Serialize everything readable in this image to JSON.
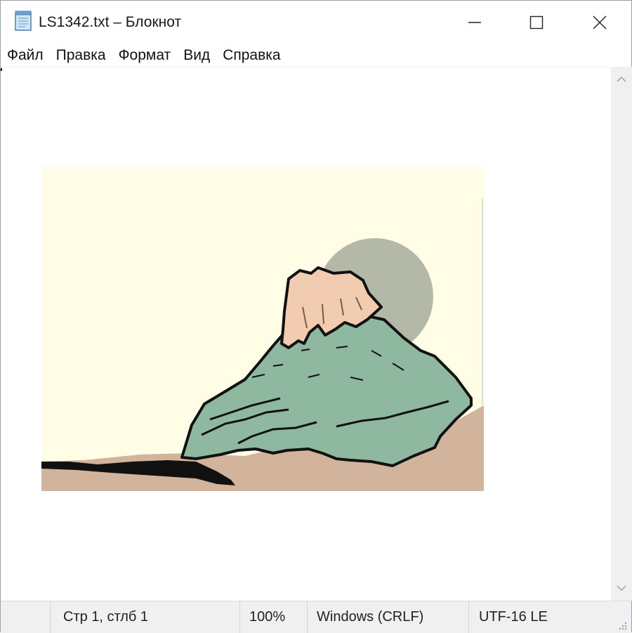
{
  "window": {
    "title": "LS1342.txt – Блокнот",
    "icon": "notepad-icon",
    "controls": [
      "minimize-icon",
      "maximize-icon",
      "close-icon"
    ]
  },
  "menu": {
    "items": [
      "Файл",
      "Правка",
      "Формат",
      "Вид",
      "Справка"
    ]
  },
  "editor": {
    "content": "mountain-clipart-image",
    "colors": {
      "sky": "#fffde6",
      "sun": "#b3b9a6",
      "rock_top": "#f1ccb0",
      "mountain": "#8fb8a0",
      "ground": "#d2b49c",
      "outline": "#111111"
    }
  },
  "status": {
    "position": "Стр 1, стлб 1",
    "zoom": "100%",
    "line_ending": "Windows (CRLF)",
    "encoding": "UTF-16 LE"
  }
}
